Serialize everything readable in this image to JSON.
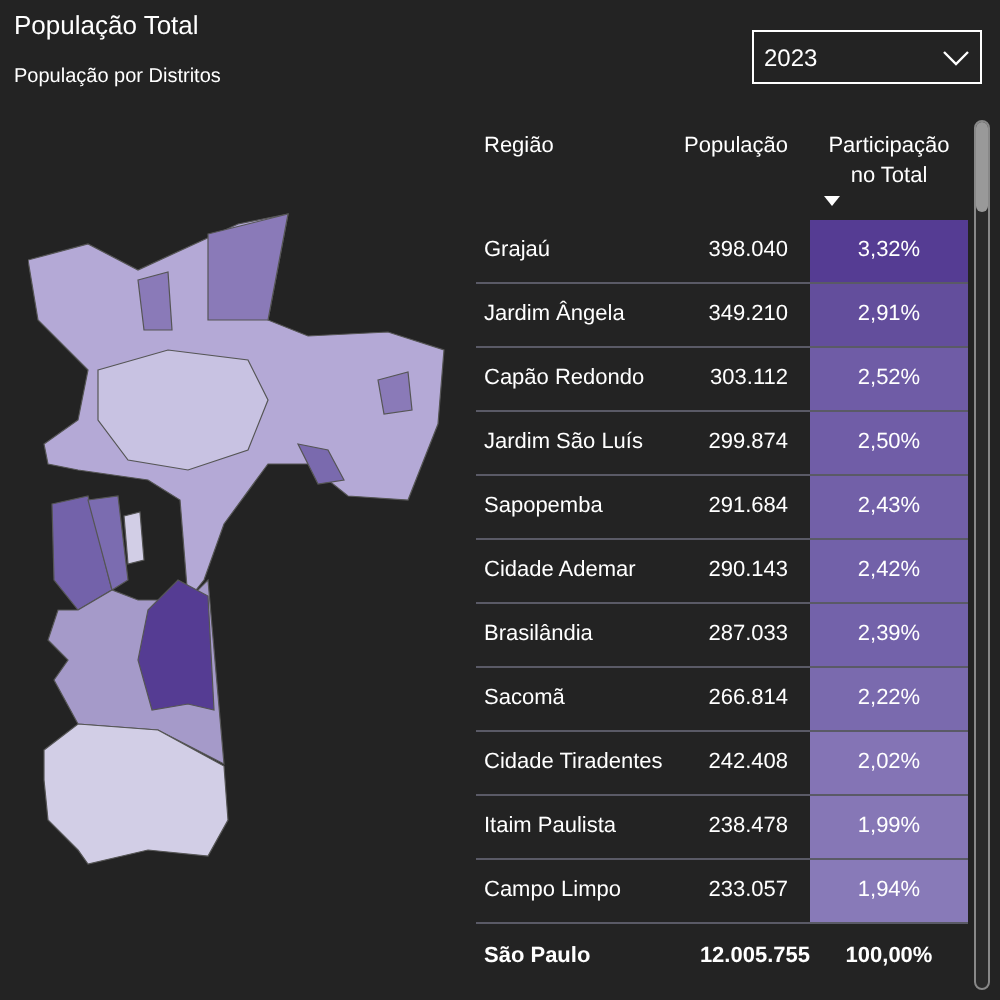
{
  "title": "População Total",
  "subtitle": "População por Distritos",
  "year_select": {
    "value": "2023"
  },
  "table": {
    "columns": [
      {
        "label": "Região",
        "sorted": false
      },
      {
        "label": "População",
        "sorted": false
      },
      {
        "label": "Participação no Total",
        "sorted": true
      }
    ],
    "rows": [
      {
        "region": "Grajaú",
        "population": "398.040",
        "share": "3,32%",
        "color": "#553c93"
      },
      {
        "region": "Jardim Ângela",
        "population": "349.210",
        "share": "2,91%",
        "color": "#634e9c"
      },
      {
        "region": "Capão Redondo",
        "population": "303.112",
        "share": "2,52%",
        "color": "#6f5ca6"
      },
      {
        "region": "Jardim São Luís",
        "population": "299.874",
        "share": "2,50%",
        "color": "#705da7"
      },
      {
        "region": "Sapopemba",
        "population": "291.684",
        "share": "2,43%",
        "color": "#7260a8"
      },
      {
        "region": "Cidade Ademar",
        "population": "290.143",
        "share": "2,42%",
        "color": "#7261a9"
      },
      {
        "region": "Brasilândia",
        "population": "287.033",
        "share": "2,39%",
        "color": "#7362aa"
      },
      {
        "region": "Sacomã",
        "population": "266.814",
        "share": "2,22%",
        "color": "#7a6aae"
      },
      {
        "region": "Cidade Tiradentes",
        "population": "242.408",
        "share": "2,02%",
        "color": "#8474b5"
      },
      {
        "region": "Itaim Paulista",
        "population": "238.478",
        "share": "1,99%",
        "color": "#8677b6"
      },
      {
        "region": "Campo Limpo",
        "population": "233.057",
        "share": "1,94%",
        "color": "#887ab8"
      }
    ],
    "total": {
      "region": "São Paulo",
      "population": "12.005.755",
      "share": "100,00%"
    }
  }
}
